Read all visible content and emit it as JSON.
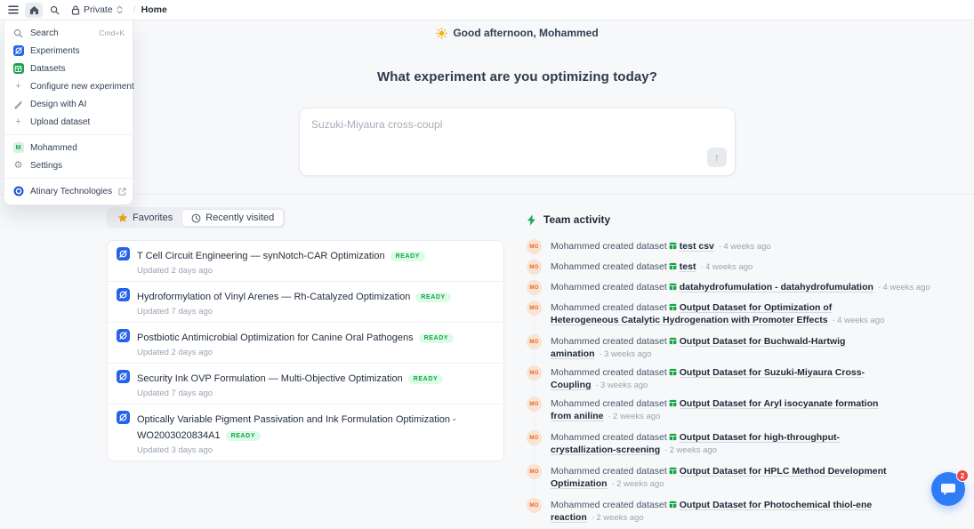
{
  "topbar": {
    "workspace": "Private",
    "separator": "/",
    "page": "Home"
  },
  "menu": {
    "search": {
      "label": "Search",
      "shortcut": "Cmd+K"
    },
    "experiments": {
      "label": "Experiments"
    },
    "datasets": {
      "label": "Datasets"
    },
    "configure": {
      "label": "Configure new experiment"
    },
    "design_ai": {
      "label": "Design with AI"
    },
    "upload": {
      "label": "Upload dataset"
    },
    "profile": {
      "label": "Mohammed",
      "avatar_initial": "M"
    },
    "settings": {
      "label": "Settings"
    },
    "org": {
      "label": "Atinary Technologies"
    }
  },
  "hero": {
    "greeting": "Good afternoon, Mohammed",
    "question": "What experiment are you optimizing today?",
    "input_placeholder": "Suzuki-Miyaura cross-coupl"
  },
  "tabs": {
    "favorites": "Favorites",
    "recent": "Recently visited"
  },
  "favorites": {
    "items": [
      {
        "title": "T Cell Circuit Engineering — synNotch-CAR Optimization",
        "status": "READY",
        "updated": "Updated 2 days ago"
      },
      {
        "title": "Hydroformylation of Vinyl Arenes — Rh-Catalyzed Optimization",
        "status": "READY",
        "updated": "Updated 7 days ago"
      },
      {
        "title": "Postbiotic Antimicrobial Optimization for Canine Oral Pathogens",
        "status": "READY",
        "updated": "Updated 2 days ago"
      },
      {
        "title": "Security Ink OVP Formulation — Multi-Objective Optimization",
        "status": "READY",
        "updated": "Updated 7 days ago"
      },
      {
        "title": "Optically Variable Pigment Passivation and Ink Formulation Optimization - WO2003020834A1",
        "status": "READY",
        "updated": "Updated 3 days ago"
      }
    ]
  },
  "activity": {
    "title": "Team activity",
    "avatar_initials": "MO",
    "dot": "·",
    "items": [
      {
        "actor": "Mohammed",
        "action": "created dataset",
        "dataset": "test csv",
        "time": "4 weeks ago"
      },
      {
        "actor": "Mohammed",
        "action": "created dataset",
        "dataset": "test",
        "time": "4 weeks ago"
      },
      {
        "actor": "Mohammed",
        "action": "created dataset",
        "dataset": "datahydrofumulation - datahydrofumulation",
        "time": "4 weeks ago"
      },
      {
        "actor": "Mohammed",
        "action": "created dataset",
        "dataset": "Output Dataset for Optimization of Heterogeneous Catalytic Hydrogenation with Promoter Effects",
        "time": "4 weeks ago"
      },
      {
        "actor": "Mohammed",
        "action": "created dataset",
        "dataset": "Output Dataset for Buchwald-Hartwig amination",
        "time": "3 weeks ago"
      },
      {
        "actor": "Mohammed",
        "action": "created dataset",
        "dataset": "Output Dataset for Suzuki-Miyaura Cross-Coupling",
        "time": "3 weeks ago"
      },
      {
        "actor": "Mohammed",
        "action": "created dataset",
        "dataset": "Output Dataset for Aryl isocyanate formation from aniline",
        "time": "2 weeks ago"
      },
      {
        "actor": "Mohammed",
        "action": "created dataset",
        "dataset": "Output Dataset for high-throughput-crystallization-screening",
        "time": "2 weeks ago"
      },
      {
        "actor": "Mohammed",
        "action": "created dataset",
        "dataset": "Output Dataset for HPLC Method Development Optimization",
        "time": "2 weeks ago"
      },
      {
        "actor": "Mohammed",
        "action": "created dataset",
        "dataset": "Output Dataset for Photochemical thiol-ene reaction",
        "time": "2 weeks ago"
      }
    ]
  },
  "chat": {
    "badge": "2"
  },
  "icons": {
    "plus": "+",
    "gear": "⚙",
    "send_arrow": "↑"
  },
  "colors": {
    "experiment_blue": "#2563eb",
    "dataset_green": "#16a34a",
    "ready_bg": "#dcfce7",
    "ready_text": "#16a34a",
    "star_amber": "#f0a818",
    "avatar_orange": "#e06a2b",
    "chat_blue": "#2e7cf6",
    "badge_red": "#ef4444"
  }
}
